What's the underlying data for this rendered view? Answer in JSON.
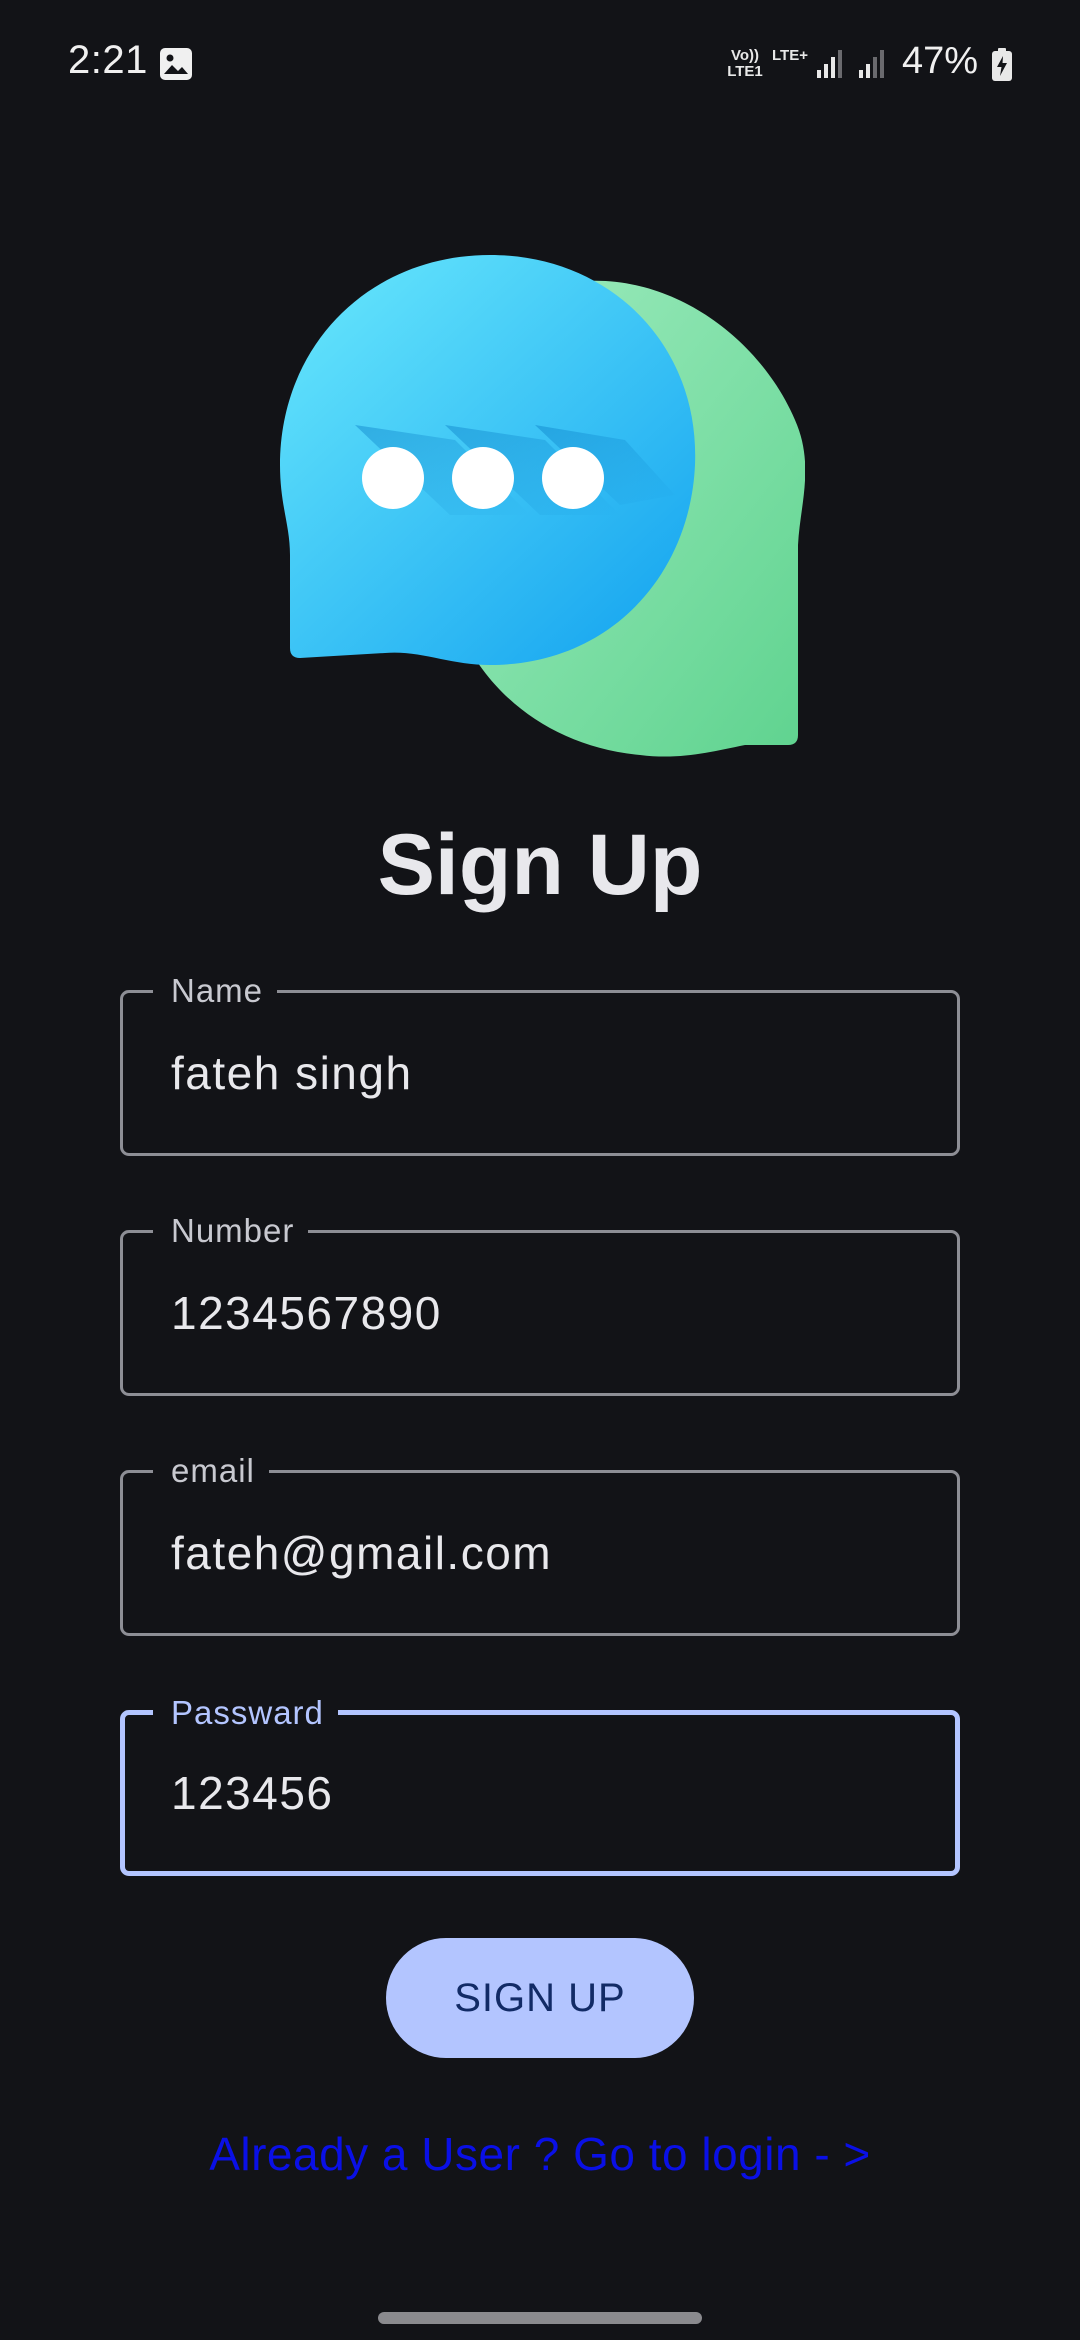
{
  "status_bar": {
    "time": "2:21",
    "volte_label": "Vo)) LTE1",
    "lte_label": "LTE+",
    "battery_percent": "47%",
    "icons": [
      "gallery-icon",
      "signal-icon",
      "signal-icon",
      "battery-charging-icon"
    ]
  },
  "logo": {
    "icon": "chat-bubbles-icon",
    "colors": {
      "front_bubble_light": "#5fe0fb",
      "front_bubble_dark": "#1aa8f0",
      "back_bubble_light": "#a0ecc0",
      "back_bubble_dark": "#5fd38f"
    }
  },
  "title": "Sign Up",
  "form": {
    "name": {
      "label": "Name",
      "value": "fateh singh"
    },
    "number": {
      "label": "Number",
      "value": "1234567890"
    },
    "email": {
      "label": "email",
      "value": "fateh@gmail.com"
    },
    "password": {
      "label": "Passward",
      "value": "123456"
    }
  },
  "signup_button": {
    "label": "SIGN UP"
  },
  "login_link": {
    "label": "Already a User ? Go to login - >"
  },
  "colors": {
    "background": "#121317",
    "accent": "#b3c5ff",
    "button_text": "#122b66",
    "link": "#0a10e6"
  }
}
